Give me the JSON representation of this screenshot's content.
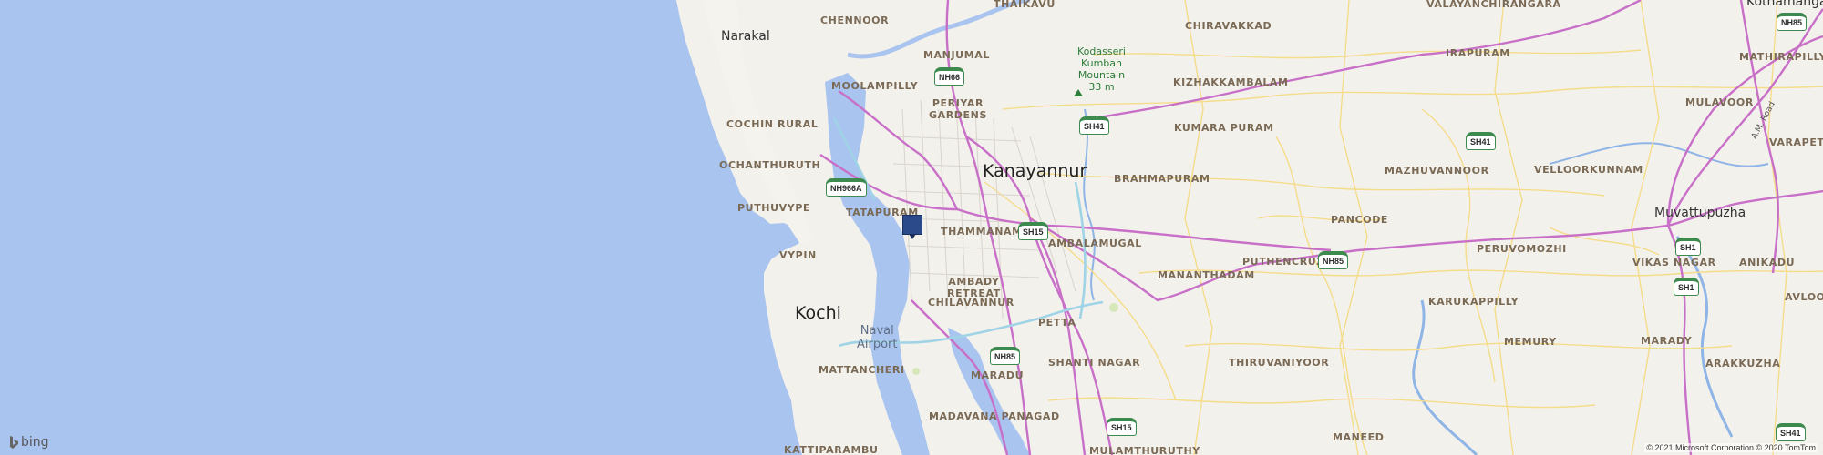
{
  "map": {
    "provider_logo_text": "bing",
    "copyright": "© 2021 Microsoft Corporation © 2020 TomTom",
    "labels": {
      "narakal": "Narakal",
      "chennoor": "CHENNOOR",
      "thaikavu": "THAIKAVU",
      "manjumal": "MANJUMAL",
      "moolampilly": "MOOLAMPILLY",
      "periyar_gardens": "PERIYAR\nGARDENS",
      "cochin_rural": "COCHIN RURAL",
      "ochanthuruth": "OCHANTHURUTH",
      "puthuvype": "PUTHUVYPE",
      "tatapuram": "TATAPURAM",
      "vypin": "VYPIN",
      "kochi": "Kochi",
      "kanayannur": "Kanayannur",
      "thammanam": "THAMMANAM",
      "ambady_retreat": "AMBADY\nRETREAT",
      "chilavannur": "CHILAVANNUR",
      "naval_airport": "Naval\nAirport",
      "mattancheri": "MATTANCHERI",
      "kattiparambu": "KATTIPARAMBU",
      "maradu": "MARADU",
      "madavana_panagad": "MADAVANA PANAGAD",
      "petta": "PETTA",
      "shanti_nagar": "SHANTI NAGAR",
      "chiravakkad": "CHIRAVAKKAD",
      "kodasseri": "Kodasseri\nKumban\nMountain\n33 m",
      "kizhakkambalam": "KIZHAKKAMBALAM",
      "kumara_puram": "KUMARA PURAM",
      "brahmapuram": "BRAHMAPURAM",
      "ambalamugal": "AMBALAMUGAL",
      "valayanchirangara": "VALAYANCHIRANGARA",
      "irapuram": "IRAPURAM",
      "mazhuvannoor": "MAZHUVANNOOR",
      "pancode": "PANCODE",
      "puthencruz": "PUTHENCRUZ",
      "mananthadam": "MANANTHADAM",
      "peruvomozhi": "PERUVOMOZHI",
      "karukappilly": "KARUKAPPILLY",
      "thiruvaniyoor": "THIRUVANIYOOR",
      "memury": "MEMURY",
      "marady": "MARADY",
      "maneed": "MANEED",
      "mulamthuruthy": "MULAMTHURUTHY",
      "kothamangalam": "Kothamangalam",
      "mathirapilly": "MATHIRAPILLY",
      "mulavoor": "MULAVOOR",
      "varapetty": "VARAPETTY",
      "velloorkunnam": "VELLOORKUNNAM",
      "muvattupuzha": "Muvattupuzha",
      "vikas_nagar": "VIKAS NAGAR",
      "anikadu": "ANIKADU",
      "avloor": "AVLOOR",
      "arakkuzha": "ARAKKUZHA",
      "am_road": "A.M. Road"
    },
    "shields": {
      "nh66": "NH66",
      "nh966a": "NH966A",
      "sh41_a": "SH41",
      "sh41_b": "SH41",
      "sh41_c": "SH41",
      "sh15_a": "SH15",
      "sh15_b": "SH15",
      "nh85_a": "NH85",
      "nh85_b": "NH85",
      "nh85_c": "NH85",
      "sh1_a": "SH1",
      "sh1_b": "SH1"
    }
  }
}
